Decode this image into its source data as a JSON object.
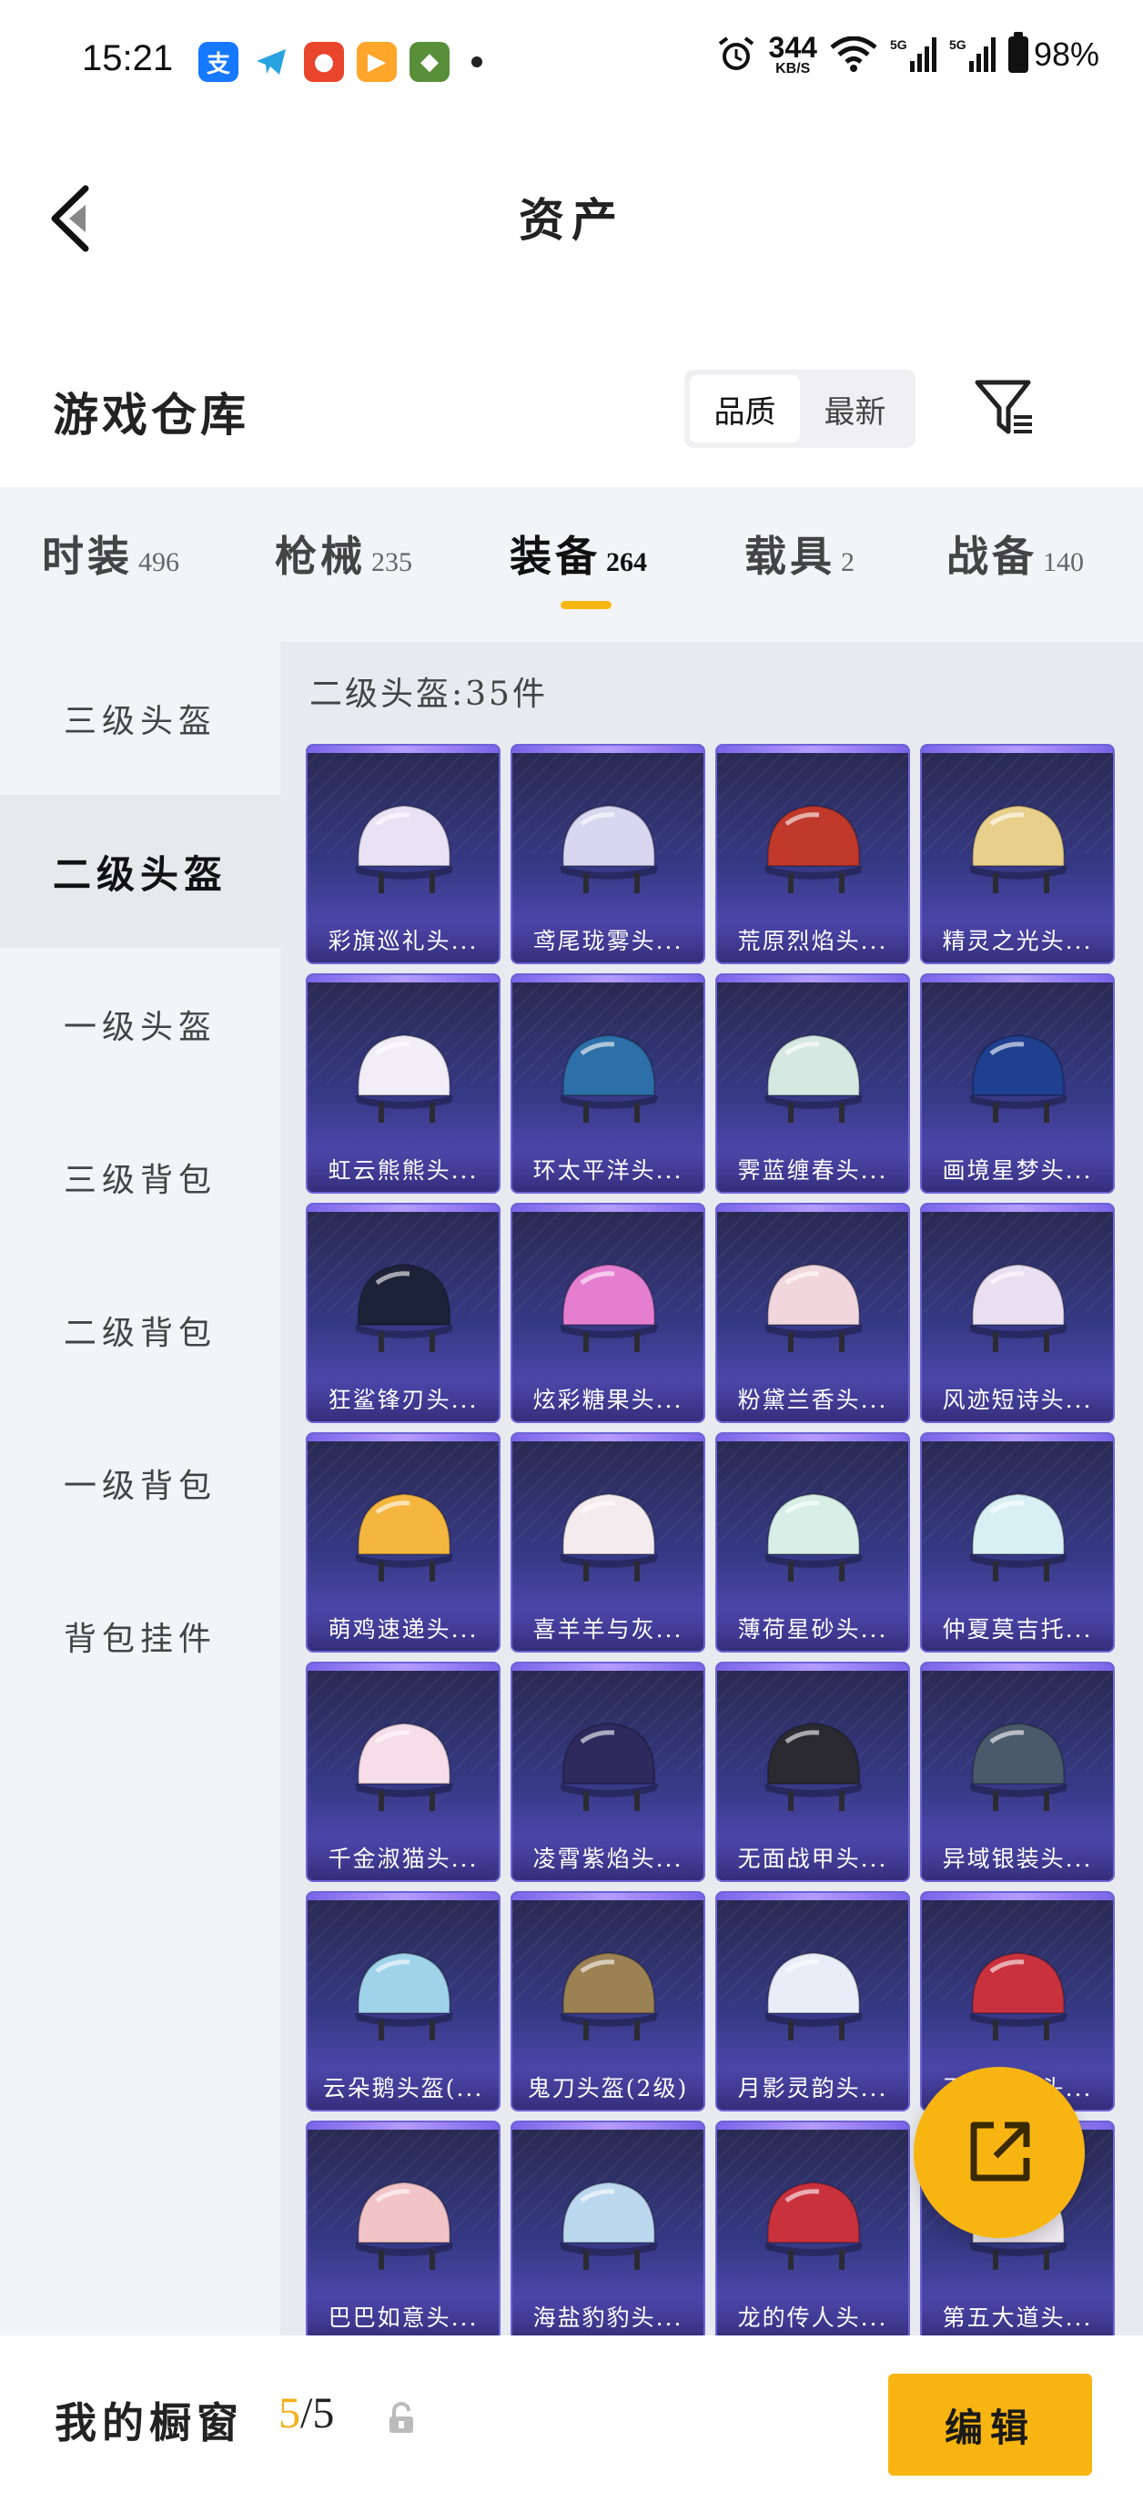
{
  "status_bar": {
    "time": "15:21",
    "net_speed_value": "344",
    "net_speed_unit": "KB/S",
    "signal1_label": "5G",
    "signal2_label": "5G",
    "battery": "98%"
  },
  "header": {
    "title": "资产"
  },
  "section": {
    "title": "游戏仓库",
    "sort_quality": "品质",
    "sort_newest": "最新"
  },
  "tabs": [
    {
      "label": "时装",
      "count": "496"
    },
    {
      "label": "枪械",
      "count": "235"
    },
    {
      "label": "装备",
      "count": "264"
    },
    {
      "label": "载具",
      "count": "2"
    },
    {
      "label": "战备",
      "count": "140"
    }
  ],
  "sidebar": [
    {
      "label": "三级头盔"
    },
    {
      "label": "二级头盔"
    },
    {
      "label": "一级头盔"
    },
    {
      "label": "三级背包"
    },
    {
      "label": "二级背包"
    },
    {
      "label": "一级背包"
    },
    {
      "label": "背包挂件"
    }
  ],
  "content": {
    "count_label": "二级头盔:35件",
    "items": [
      {
        "name": "彩旗巡礼头...",
        "color": "#e9e2f4"
      },
      {
        "name": "鸢尾珑雾头...",
        "color": "#d9d6ef"
      },
      {
        "name": "荒原烈焰头...",
        "color": "#c0392b"
      },
      {
        "name": "精灵之光头...",
        "color": "#e8cf8a"
      },
      {
        "name": "虹云熊熊头...",
        "color": "#f1eef8"
      },
      {
        "name": "环太平洋头...",
        "color": "#2d6fa8"
      },
      {
        "name": "霁蓝缠春头...",
        "color": "#d6e8e2"
      },
      {
        "name": "画境星梦头...",
        "color": "#1f3f8f"
      },
      {
        "name": "狂鲨锋刃头...",
        "color": "#1c2338"
      },
      {
        "name": "炫彩糖果头...",
        "color": "#e67ed0"
      },
      {
        "name": "粉黛兰香头...",
        "color": "#f1d7dd"
      },
      {
        "name": "风迹短诗头...",
        "color": "#eadff0"
      },
      {
        "name": "萌鸡速递头...",
        "color": "#f5b640"
      },
      {
        "name": "喜羊羊与灰...",
        "color": "#f4ebee"
      },
      {
        "name": "薄荷星砂头...",
        "color": "#d7efe6"
      },
      {
        "name": "仲夏莫吉托...",
        "color": "#d8f0f4"
      },
      {
        "name": "千金淑猫头...",
        "color": "#f6dde7"
      },
      {
        "name": "凌霄紫焰头...",
        "color": "#2e2a5e"
      },
      {
        "name": "无面战甲头...",
        "color": "#2a2a30"
      },
      {
        "name": "异域银装头...",
        "color": "#4b5a6a"
      },
      {
        "name": "云朵鹅头盔(...",
        "color": "#9fd3ea"
      },
      {
        "name": "鬼刀头盔(2级)",
        "color": "#9c8152"
      },
      {
        "name": "月影灵韵头...",
        "color": "#e9edf7"
      },
      {
        "name": "玉兔星辰头...",
        "color": "#c9313d"
      },
      {
        "name": "巴巴如意头...",
        "color": "#f2c3c7"
      },
      {
        "name": "海盐豹豹头...",
        "color": "#bcd8ee"
      },
      {
        "name": "龙的传人头...",
        "color": "#c9313d"
      },
      {
        "name": "第五大道头...",
        "color": "#eee8ef"
      }
    ]
  },
  "bottom": {
    "showcase_label": "我的橱窗",
    "showcase_current": "5",
    "showcase_total": "/5",
    "edit_label": "编辑"
  },
  "colors": {
    "accent": "#f8b512",
    "card_bg": "#363984"
  },
  "icons": [
    "back-arrow-icon",
    "filter-icon",
    "share-icon",
    "lock-icon",
    "alarm-icon",
    "wifi-icon"
  ]
}
